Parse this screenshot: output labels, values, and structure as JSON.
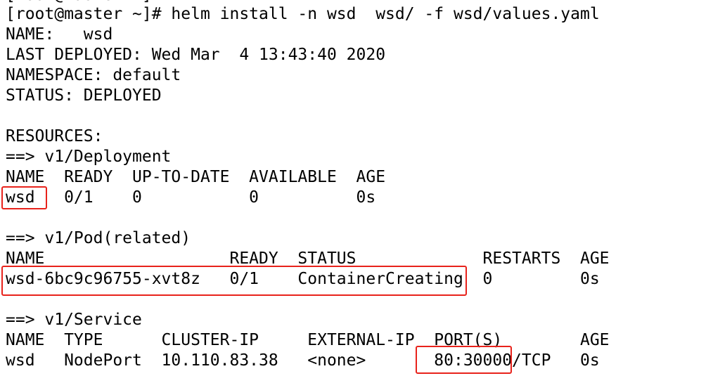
{
  "terminal": {
    "partial_top": "[root@master ~]#",
    "prompt": "[root@master ~]# helm install -n wsd  wsd/ -f wsd/values.yaml",
    "name_line": "NAME:   wsd",
    "last_deployed": "LAST DEPLOYED: Wed Mar  4 13:43:40 2020",
    "namespace": "NAMESPACE: default",
    "status": "STATUS: DEPLOYED",
    "resources": "RESOURCES:",
    "deployment": {
      "heading": "==> v1/Deployment",
      "header": "NAME  READY  UP-TO-DATE  AVAILABLE  AGE",
      "row": "wsd   0/1    0           0          0s"
    },
    "pod": {
      "heading": "==> v1/Pod(related)",
      "header": "NAME                   READY  STATUS             RESTARTS  AGE",
      "row": "wsd-6bc9c96755-xvt8z   0/1    ContainerCreating  0         0s"
    },
    "service": {
      "heading": "==> v1/Service",
      "header": "NAME  TYPE      CLUSTER-IP     EXTERNAL-IP  PORT(S)        AGE",
      "row": "wsd   NodePort  10.110.83.38   <none>       80:30000/TCP   0s"
    }
  },
  "highlight_color": "#e8221b"
}
